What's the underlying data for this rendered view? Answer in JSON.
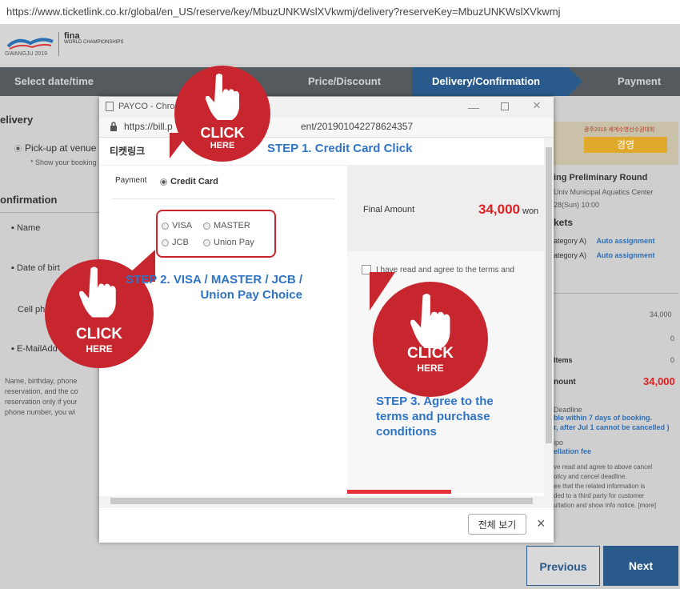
{
  "browser": {
    "url": "https://www.ticketlink.co.kr/global/en_US/reserve/key/MbuzUNKWslXVkwmj/delivery?reserveKey=MbuzUNKWslXVkwmj"
  },
  "site": {
    "logo_sub": "GWANGJU 2019",
    "fina_title": "fina",
    "fina_sub": "WORLD CHAMPIONSHIPS"
  },
  "steps": [
    {
      "label": "Select date/time"
    },
    {
      "label": "Price/Discount"
    },
    {
      "label": "Delivery/Confirmation"
    },
    {
      "label": "Payment"
    }
  ],
  "left_panel": {
    "delivery_heading": "elivery",
    "pickup_label": "Pick-up at venue",
    "pickup_note": "* Show your booking",
    "confirmation_heading": "onfirmation",
    "name_label": "Name",
    "dob_label": "Date of birt",
    "cell_label": "Cell ph",
    "email_label": "E-MailAdd",
    "notice_lines": [
      "Name, birthday, phone",
      "reservation, and the co",
      "reservation only if your",
      "phone number, you wi"
    ]
  },
  "right_panel": {
    "event_banner_text": "광주2019 세계수영선수권대회",
    "event_banner_sub": "경영",
    "round_title": "ing Preliminary Round",
    "venue": "Univ Municipal Aquatics Center",
    "date": "28(Sun) 10:00",
    "tickets_heading": "kets",
    "ticket_rows": [
      {
        "category": "ategory A)",
        "assign": "Auto assignment"
      },
      {
        "category": "ategory A)",
        "assign": "Auto assignment"
      }
    ],
    "price_value": "34,000",
    "zero1": "0",
    "zero2": "0",
    "items_label": "Items",
    "amount_label": "nount",
    "amount_value": "34,000",
    "deadline_label": "Deadline",
    "deadline_text1": "ble within 7 days of booking.",
    "deadline_text2": "r, after Jul 1 cannot be cancelled )",
    "fee_label1": "ipo",
    "fee_label2": "ellation fee",
    "agree_lines": [
      "ve read and agree to above cancel",
      "olicy and cancel deadline.",
      "ee that the related information is",
      "ded to a third party for customer",
      "ultation and show info notice. [more]"
    ],
    "previous_label": "Previous",
    "next_label": "Next"
  },
  "popup": {
    "window_title": "PAYCO - Chro",
    "url_start": "https://bill.p",
    "url_end": "ent/201901042278624357",
    "brand": "티켓링크",
    "payment_label": "Payment",
    "credit_card_label": "Credit Card",
    "card_options": [
      "VISA",
      "MASTER",
      "JCB",
      "Union Pay"
    ],
    "final_amount_label": "Final Amount",
    "final_amount_value": "34,000",
    "final_amount_unit": "won",
    "agree_text": "I have read and agree to the terms and",
    "footer_button": "전체 보기",
    "close_symbol": "×"
  },
  "annotations": {
    "click_word": "CLICK",
    "here_word": "HERE",
    "step1": "STEP 1. Credit Card Click",
    "step2_line1": "STEP 2. VISA / MASTER / JCB /",
    "step2_line2": "Union Pay Choice",
    "step3_line1": "STEP 3. Agree to the",
    "step3_line2": "terms and purchase",
    "step3_line3": "conditions"
  },
  "colors": {
    "accent_red": "#c8262e",
    "step_blue": "#2f74c4",
    "active_step": "#2a5a8c",
    "amount_red": "#e02020"
  },
  "icons": [
    "lock-icon",
    "pointing-hand-icon",
    "minimize-icon",
    "maximize-icon",
    "close-icon"
  ]
}
